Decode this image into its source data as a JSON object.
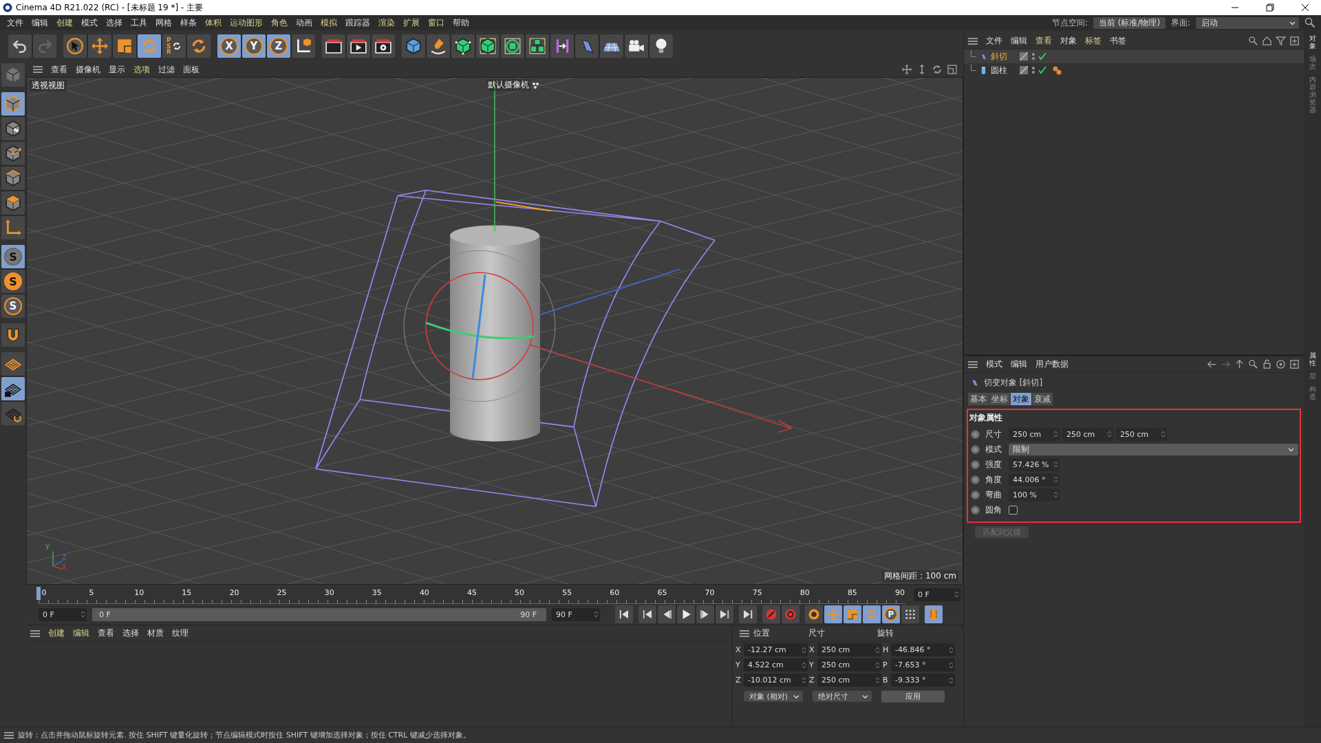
{
  "window": {
    "title": "Cinema 4D R21.022 (RC) - [未标题 19 *] - 主要"
  },
  "menu": [
    {
      "label": "文件",
      "accent": false
    },
    {
      "label": "编辑",
      "accent": false
    },
    {
      "label": "创建",
      "accent": true
    },
    {
      "label": "模式",
      "accent": false
    },
    {
      "label": "选择",
      "accent": false
    },
    {
      "label": "工具",
      "accent": false
    },
    {
      "label": "网格",
      "accent": false
    },
    {
      "label": "样条",
      "accent": false
    },
    {
      "label": "体积",
      "accent": true
    },
    {
      "label": "运动图形",
      "accent": true
    },
    {
      "label": "角色",
      "accent": true
    },
    {
      "label": "动画",
      "accent": false
    },
    {
      "label": "模拟",
      "accent": true
    },
    {
      "label": "跟踪器",
      "accent": false
    },
    {
      "label": "渲染",
      "accent": true
    },
    {
      "label": "扩展",
      "accent": true
    },
    {
      "label": "窗口",
      "accent": true
    },
    {
      "label": "帮助",
      "accent": false
    }
  ],
  "node_space": {
    "label": "节点空间:",
    "value": "当前 (标准/物理)"
  },
  "interface": {
    "label": "界面:",
    "value": "启动"
  },
  "toolbar": [
    [
      {
        "kind": "undo",
        "active": false
      },
      {
        "kind": "redo",
        "active": false
      }
    ],
    [
      {
        "kind": "select",
        "active": false
      },
      {
        "kind": "move",
        "active": false
      },
      {
        "kind": "scale",
        "active": false
      },
      {
        "kind": "rotate",
        "active": true
      },
      {
        "kind": "psr",
        "label": "PSR",
        "active": false
      },
      {
        "kind": "recent-tool",
        "active": false
      }
    ],
    [
      {
        "kind": "x-lock",
        "label": "X",
        "active": true
      },
      {
        "kind": "y-lock",
        "label": "Y",
        "active": true
      },
      {
        "kind": "z-lock",
        "label": "Z",
        "active": true
      },
      {
        "kind": "coordinate-system",
        "active": false
      }
    ],
    [
      {
        "kind": "render-region",
        "active": false
      },
      {
        "kind": "render-view",
        "active": false
      },
      {
        "kind": "render-settings",
        "active": false
      }
    ],
    [
      {
        "kind": "cube",
        "active": false
      },
      {
        "kind": "pen",
        "active": false
      },
      {
        "kind": "subdivision",
        "active": false
      },
      {
        "kind": "extrude",
        "active": false
      },
      {
        "kind": "array",
        "active": false
      },
      {
        "kind": "cloner",
        "active": false
      },
      {
        "kind": "symmetry",
        "active": false
      },
      {
        "kind": "deformer",
        "active": false
      },
      {
        "kind": "floor",
        "active": false
      },
      {
        "kind": "camera",
        "active": false
      },
      {
        "kind": "light",
        "active": false
      }
    ]
  ],
  "left_tools": [
    [
      {
        "kind": "view-switch",
        "active": false
      }
    ],
    [
      {
        "kind": "model",
        "active": true
      },
      {
        "kind": "texture",
        "active": false
      },
      {
        "kind": "points",
        "active": false
      },
      {
        "kind": "edges",
        "active": false
      },
      {
        "kind": "polygons",
        "active": false
      },
      {
        "kind": "axis",
        "active": false
      }
    ],
    [
      {
        "kind": "snap",
        "label": "S",
        "active": true
      },
      {
        "kind": "snap-soft",
        "label": "S",
        "active": false
      },
      {
        "kind": "snap-quantize",
        "label": "S",
        "active": false
      }
    ],
    [
      {
        "kind": "magnet",
        "active": false
      }
    ],
    [
      {
        "kind": "workplane",
        "active": false
      },
      {
        "kind": "workplane-lock",
        "active": true
      },
      {
        "kind": "workplane-sync",
        "active": false
      }
    ]
  ],
  "viewport": {
    "menu": [
      {
        "label": "查看",
        "accent": false
      },
      {
        "label": "摄像机",
        "accent": false
      },
      {
        "label": "显示",
        "accent": false
      },
      {
        "label": "选项",
        "accent": true
      },
      {
        "label": "过滤",
        "accent": false
      },
      {
        "label": "面板",
        "accent": false
      }
    ],
    "view_name": "透视视图",
    "camera": "默认摄像机",
    "grid_spacing": "网格间距 : 100 cm",
    "axis_labels": [
      "Y",
      "Z",
      "X"
    ]
  },
  "timeline": {
    "ticks": [
      "0",
      "5",
      "10",
      "15",
      "20",
      "25",
      "30",
      "35",
      "40",
      "45",
      "50",
      "55",
      "60",
      "65",
      "70",
      "75",
      "80",
      "85",
      "90"
    ],
    "playhead": {
      "level": 0
    },
    "current_frame": "0 F",
    "start": "0 F",
    "range_start": "0 F",
    "range_end": "90 F",
    "end": "90 F",
    "buttons": [
      [
        {
          "kind": "go-start",
          "active": false
        }
      ],
      [
        {
          "kind": "prev-key",
          "active": false
        },
        {
          "kind": "prev-frame",
          "active": false
        },
        {
          "kind": "play",
          "active": false
        },
        {
          "kind": "next-frame",
          "active": false
        },
        {
          "kind": "next-key",
          "active": false
        }
      ],
      [
        {
          "kind": "go-end",
          "active": false
        }
      ],
      [
        {
          "kind": "record",
          "active": false
        },
        {
          "kind": "autokey",
          "active": false
        }
      ],
      [
        {
          "kind": "keyframe-selection",
          "active": false
        },
        {
          "kind": "key-position",
          "active": true
        },
        {
          "kind": "key-scale",
          "active": true
        },
        {
          "kind": "key-rotation",
          "active": true
        },
        {
          "kind": "key-parameter",
          "label": "P",
          "active": true
        },
        {
          "kind": "key-pla",
          "active": false
        }
      ],
      [
        {
          "kind": "timeline-window",
          "active": true
        }
      ]
    ]
  },
  "materials": {
    "menu": [
      {
        "label": "创建",
        "accent": true
      },
      {
        "label": "编辑",
        "accent": true
      },
      {
        "label": "查看",
        "accent": false
      },
      {
        "label": "选择",
        "accent": false
      },
      {
        "label": "材质",
        "accent": false
      },
      {
        "label": "纹理",
        "accent": false
      }
    ]
  },
  "coordinates": {
    "headers": [
      "位置",
      "尺寸",
      "旋转"
    ],
    "rows": [
      {
        "axis": "X",
        "position": "-12.27 cm",
        "size_axis": "X",
        "size": "250 cm",
        "rotation_axis": "H",
        "rotation": "-46.846 °"
      },
      {
        "axis": "Y",
        "position": "4.522 cm",
        "size_axis": "Y",
        "size": "250 cm",
        "rotation_axis": "P",
        "rotation": "-7.653 °"
      },
      {
        "axis": "Z",
        "position": "-10.012 cm",
        "size_axis": "Z",
        "size": "250 cm",
        "rotation_axis": "B",
        "rotation": "-9.333 °"
      }
    ],
    "position_mode": "对象 (相对)",
    "size_mode": "绝对尺寸",
    "apply": "应用"
  },
  "object_manager": {
    "menu": [
      {
        "label": "文件",
        "accent": false
      },
      {
        "label": "编辑",
        "accent": false
      },
      {
        "label": "查看",
        "accent": true
      },
      {
        "label": "对象",
        "accent": false
      },
      {
        "label": "标签",
        "accent": true
      },
      {
        "label": "书签",
        "accent": false
      }
    ],
    "objects": [
      {
        "name": "斜切",
        "kind": "deformer",
        "selected": true,
        "enabled": true,
        "tag": false
      },
      {
        "name": "圆柱",
        "kind": "cylinder",
        "selected": false,
        "enabled": true,
        "tag": true
      }
    ]
  },
  "attributes": {
    "menu": [
      {
        "label": "模式",
        "accent": false
      },
      {
        "label": "编辑",
        "accent": false
      },
      {
        "label": "用户数据",
        "accent": false
      }
    ],
    "title": "切变对象 [斜切]",
    "tabs": [
      {
        "label": "基本",
        "selected": false
      },
      {
        "label": "坐标",
        "selected": false
      },
      {
        "label": "对象",
        "selected": true
      },
      {
        "label": "衰减",
        "selected": false
      }
    ],
    "section": "对象属性",
    "highlighted": true,
    "params": [
      {
        "kind": "vector",
        "label": "尺寸",
        "values": [
          "250 cm",
          "250 cm",
          "250 cm"
        ]
      },
      {
        "kind": "dropdown",
        "label": "模式",
        "value": "限制"
      },
      {
        "kind": "number",
        "label": "强度",
        "value": "57.426 %"
      },
      {
        "kind": "number",
        "label": "角度",
        "value": "44.006 °"
      },
      {
        "kind": "number",
        "label": "弯曲",
        "value": "100 %"
      },
      {
        "kind": "checkbox",
        "label": "圆角",
        "checked": false
      }
    ],
    "button": {
      "label": "匹配到父级",
      "disabled": true
    }
  },
  "side_tabs_top": [
    {
      "label": "对象",
      "selected": true
    },
    {
      "label": "场次",
      "selected": false
    },
    {
      "label": "内容浏览器",
      "selected": false
    }
  ],
  "side_tabs_bottom": [
    {
      "label": "属性",
      "selected": true
    },
    {
      "label": "层",
      "selected": false
    },
    {
      "label": "构造",
      "selected": false
    }
  ],
  "status_bar": "旋转：点击并拖动鼠标旋转元素. 按住 SHIFT 键量化旋转；节点编辑模式时按住 SHIFT 键增加选择对象；按住 CTRL 键减少选择对象。"
}
